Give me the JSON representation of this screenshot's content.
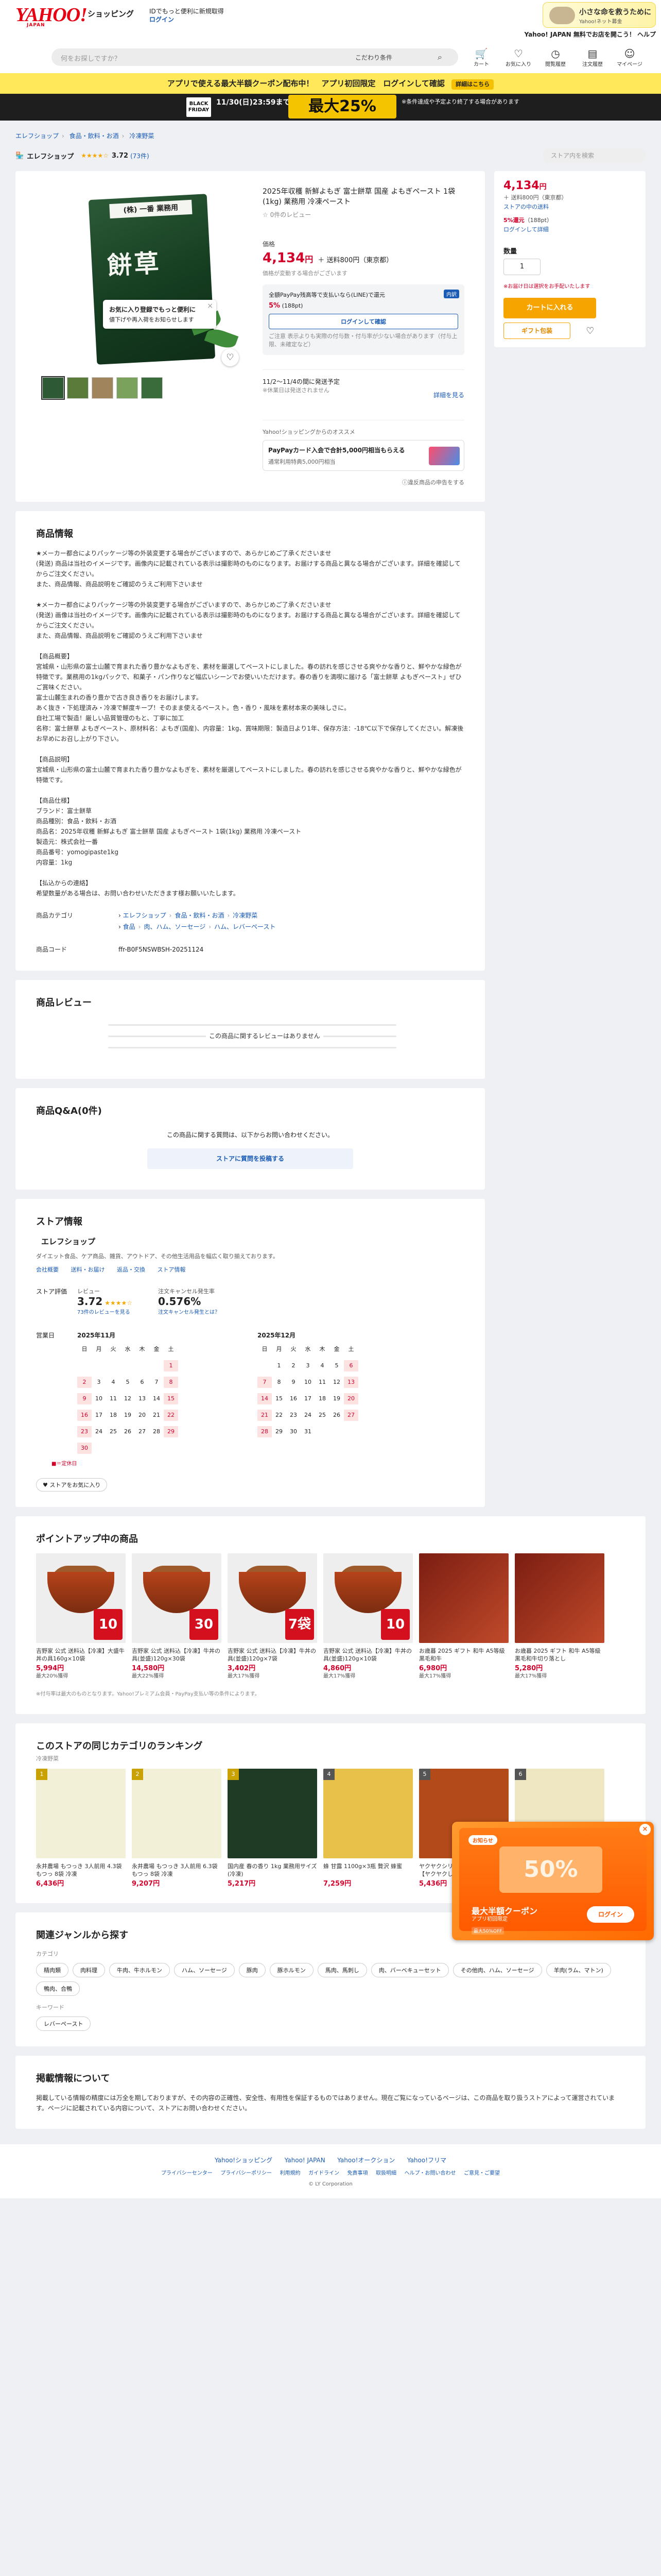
{
  "header": {
    "shop": "ショッピング",
    "tagline": "IDでもっと便利に新規取得",
    "login": "ログイン",
    "search_placeholder": "何をお探しですか？",
    "search_cond": "こだわり条件",
    "icons": [
      "カート",
      "お気に入り",
      "閲覧履歴",
      "注文履歴",
      "マイページ"
    ],
    "promo_line": "Yahoo! JAPAN 無料でお店を開こう！ ヘルプ",
    "promo_tx": "小さな命を救うために",
    "promo_tx2": "Yahoo!ネット募金"
  },
  "yellow_bar": {
    "text": "アプリで使える最大半額クーポン配布中！　アプリ初回限定　ログインして確認",
    "sub": "※対象者のみ",
    "badge": "詳細はこちら"
  },
  "black_friday": {
    "logo": "BLACK FRIDAY",
    "main": "11/30(日)23:59まで",
    "pct": "最大25%",
    "note": "※条件達成や予定より終了する場合があります"
  },
  "breadcrumb": [
    "エレフショップ",
    "食品・飲料・お酒",
    "冷凍野菜"
  ],
  "store_bar": {
    "name": "エレフショップ",
    "stars": "★★★★☆",
    "score": "3.72",
    "count": "(73件)",
    "search_placeholder": "ストア内を検索"
  },
  "product": {
    "title": "2025年収穫 新鮮よもぎ 富士餅草 国産 よもぎペースト 1袋(1kg) 業務用 冷凍ペースト",
    "reviews": "☆ 0件のレビュー",
    "price_label": "価格",
    "price": "4,134",
    "yen": "円",
    "ship": "＋ 送料800円（東京都）",
    "price_note": "価格が変動する場合がございます",
    "pkg_label": "(株) 一番 業務用",
    "pkg_name": "餅草",
    "tip_title": "お気に入り登録でもっと便利に",
    "tip_sub": "値下げや再入荷をお知らせします",
    "pay_title": "全額PayPay残高等で支払いなら(LINE)で還元",
    "pay_pct": "5%",
    "pay_pts": "(188pt)",
    "pay_badge": "内訳",
    "pay_btn": "ログインして確認",
    "pay_small": "ご注意 表示よりも実際の付与数・付与率が少ない場合があります（付与上限、未確定など）",
    "delivery": "11/2〜11/4の間に発送予定",
    "delivery_note": "※休業日は発送されません",
    "more": "詳細を見る",
    "pp_title": "Yahoo!ショッピングからのオススメ",
    "pp_card": "PayPayカード入会で合計5,000円相当もらえる",
    "pp_sub": "通常利用特典5,000円相当",
    "report": "ⓘ違反商品の申告をする"
  },
  "right": {
    "price": "4,134",
    "yen": "円",
    "ship": "＋ 送料800円（東京都）",
    "jump": "ストアの中の送料",
    "pt": "5%還元",
    "pts": "（188pt）",
    "pt_more": "ログインして詳細",
    "qty_label": "数量",
    "qty": "1",
    "note": "※お届け日は選択をお手配いたします",
    "cart": "カートに入れる",
    "gift": "ギフト包装"
  },
  "desc": {
    "title": "商品情報",
    "body": "★メーカー都合によりパッケージ等の外装変更する場合がございますので、あらかじめご了承くださいませ\n(発送) 商品は当社のイメージです。画像内に記載されている表示は撮影時のものになります。お届けする商品と異なる場合がございます。詳細を確認してからご注文ください。\nまた、商品情報、商品説明をご確認のうえご利用下さいませ\n\n★メーカー都合によりパッケージ等の外装変更する場合がございますので、あらかじめご了承くださいませ\n(発送) 画像は当社のイメージです。画像内に記載されている表示は撮影時のものになります。お届けする商品と異なる場合がございます。詳細を確認してからご注文ください。\nまた、商品情報、商品説明をご確認のうえご利用下さいませ\n\n【商品概要】\n宮城県・山形県の富士山麓で育まれた香り豊かなよもぎを、素材を厳選してペーストにしました。春の訪れを感じさせる爽やかな香りと、鮮やかな緑色が特徴です。業務用の1kgパックで、和菓子・パン作りなど幅広いシーンでお使いいただけます。春の香りを満喫に届ける「富士餅草 よもぎペースト」ぜひご賞味ください。\n富士山麓生まれの香り豊かで古き良き香りをお届けします。\nあく抜き・下処理済み・冷凍で鮮度キープ！そのまま使えるペースト。色・香り・風味を素材本来の美味しさに。\n自社工場で製造！厳しい品質管理のもと、丁寧に加工\n名称：富士餅草 よもぎペースト、原材料名：よもぎ(国産)、内容量：1kg、賞味期限：製造日より1年、保存方法：-18℃以下で保存してください。解凍後お早めにお召し上がり下さい。\n\n【商品説明】\n宮城県・山形県の富士山麓で育まれた香り豊かなよもぎを、素材を厳選してペーストにしました。春の訪れを感じさせる爽やかな香りと、鮮やかな緑色が特徴です。\n\n【商品仕様】\nブランド：富士餅草\n商品種別：食品・飲料・お酒\n商品名：2025年収穫 新鮮よもぎ 富士餅草 国産 よもぎペースト 1袋(1kg) 業務用 冷凍ペースト\n製造元：株式会社一番\n商品番号：yomogipaste1kg\n内容量：1kg\n\n【払込からの連絡】\n希望数量がある場合は、お問い合わせいただきます様お願いいたします。",
    "cat_label": "商品カテゴリ",
    "cats1": [
      "エレフショップ",
      "食品・飲料・お酒",
      "冷凍野菜"
    ],
    "cats2": [
      "食品",
      "肉、ハム、ソーセージ",
      "ハム、レバーペースト"
    ],
    "code_label": "商品コード",
    "code": "ffr-B0F5NSWBSH-20251124"
  },
  "reviews": {
    "title": "商品レビュー",
    "empty": "この商品に関するレビューはありません"
  },
  "qa": {
    "title": "商品Q&A(0件)",
    "text": "この商品に関する質問は、以下からお問い合わせください。",
    "btn": "ストアに質問を投稿する"
  },
  "store": {
    "title": "ストア情報",
    "name": "エレフショップ",
    "desc": "ダイエット食品、ケア商品、雑貨、アウトドア、その他生活用品を幅広く取り揃えております。",
    "links": [
      "会社概要",
      "送料・お届け",
      "返品・交換",
      "ストア情報"
    ],
    "eval_label": "ストア評価",
    "rev_label": "レビュー",
    "score": "3.72",
    "stars": "★★★★☆",
    "rev_link": "73件のレビューを見る",
    "cancel_label": "注文キャンセル発生率",
    "cancel": "0.576%",
    "cancel_link": "注文キャンセル発生とは？",
    "biz_label": "営業日",
    "m1": "2025年11月",
    "m2": "2025年12月",
    "weekdays": [
      "日",
      "月",
      "火",
      "水",
      "木",
      "金",
      "土"
    ],
    "legend": "■＝定休日",
    "follow": "♥ ストアをお気に入り"
  },
  "points_section": {
    "title": "ポイントアップ中の商品",
    "items": [
      {
        "name": "吉野家 公式 送料込【冷凍】大盛牛丼の具160g×10袋",
        "price": "5,994円",
        "note": "最大20%獲得",
        "bag": "10袋"
      },
      {
        "name": "吉野家 公式 送料込【冷凍】牛丼の具(並盛)120g×30袋",
        "price": "14,580円",
        "note": "最大22%獲得",
        "bag": "30袋"
      },
      {
        "name": "吉野家 公式 送料込【冷凍】牛丼の具(並盛)120g×7袋",
        "price": "3,402円",
        "note": "最大17%獲得",
        "bag": "7袋"
      },
      {
        "name": "吉野家 公式 送料込【冷凍】牛丼の具(並盛)120g×10袋",
        "price": "4,860円",
        "note": "最大17%獲得",
        "bag": "10袋"
      },
      {
        "name": "お歳暮 2025 ギフト 和牛 A5等級 黒毛和牛",
        "price": "6,980円",
        "note": "最大17%獲得",
        "bag": ""
      },
      {
        "name": "お歳暮 2025 ギフト 和牛 A5等級 黒毛和牛切り落とし",
        "price": "5,280円",
        "note": "最大17%獲得",
        "bag": ""
      }
    ],
    "fine": "※付与率は最大のものとなります。Yahoo!プレミアム会員・PayPay支払い等の条件によります。"
  },
  "ranking": {
    "title": "このストアの同じカテゴリのランキング",
    "sub": "冷凍野菜",
    "items": [
      {
        "rank": "1",
        "name": "永井農場 もつっき 3人前用 4.3袋 もつっ 8袋 冷凍",
        "price": "6,436円"
      },
      {
        "rank": "2",
        "name": "永井農場 もつっき 3人前用 6.3袋 もつっ 8袋 冷凍",
        "price": "9,207円"
      },
      {
        "rank": "3",
        "name": "国内産 春の香り 1kg 業務用サイズ(冷凍)",
        "price": "5,217円"
      },
      {
        "rank": "4",
        "name": "蜂 甘露 1100g×3瓶 贅沢 蜂蜜",
        "price": "7,259円"
      },
      {
        "rank": "5",
        "name": "ヤクヤクシリーズ 3種詰め合わせ【ヤクヤクしょう..】",
        "price": "5,436円"
      },
      {
        "rank": "6",
        "name": "半田素 半田 羊羹作り 1kg 300g×20入",
        "price": "6,761円"
      }
    ]
  },
  "genre": {
    "title": "関連ジャンルから探す",
    "sub1": "カテゴリ",
    "tags": [
      "精肉類",
      "肉料理",
      "牛肉、牛ホルモン",
      "ハム、ソーセージ",
      "豚肉",
      "豚ホルモン",
      "馬肉、馬刺し",
      "肉、バーベキューセット",
      "その他肉、ハム、ソーセージ",
      "羊肉(ラム、マトン)",
      "鴨肉、合鴨"
    ],
    "sub2": "キーワード",
    "kw": [
      "レバーペースト"
    ]
  },
  "notice": {
    "title": "掲載情報について",
    "body": "掲載している情報の精度には万全を期しておりますが、その内容の正確性、安全性、有用性を保証するものではありません。現在ご覧になっているページは、この商品を取り扱うストアによって運営されています。ページに記載されている内容について、ストアにお問い合わせください。"
  },
  "footer": {
    "main": [
      "Yahoo!ショッピング",
      "Yahoo! JAPAN",
      "Yahoo!オークション",
      "Yahoo!フリマ"
    ],
    "sub": [
      "プライバシーセンター",
      "プライバシーポリシー",
      "利用規約",
      "ガイドライン",
      "免責事項",
      "取扱明細",
      "ヘルプ・お問い合わせ",
      "ご意見・ご要望"
    ],
    "copy": "© LY Corporation"
  },
  "coupon": {
    "pill": "お知らせ",
    "pct": "50%",
    "title": "最大半額クーポン",
    "sub": "アプリ初回限定",
    "btn": "ログイン",
    "cls": "×",
    "b3": "最大50%OFF"
  }
}
